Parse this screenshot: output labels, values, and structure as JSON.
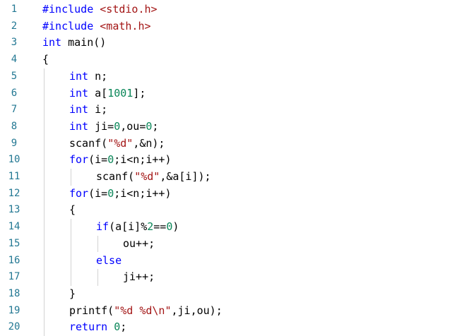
{
  "editor": {
    "colors": {
      "line_number": "#237893",
      "keyword": "#0000ff",
      "string": "#a31515",
      "number": "#098658",
      "text": "#000000",
      "indent_guide": "#d3d3d3"
    },
    "lines": [
      {
        "number": "1",
        "indent": 0,
        "tokens": [
          {
            "t": "#include",
            "k": "preproc"
          },
          {
            "t": " ",
            "k": "plain"
          },
          {
            "t": "<stdio.h>",
            "k": "include"
          }
        ]
      },
      {
        "number": "2",
        "indent": 0,
        "tokens": [
          {
            "t": "#include",
            "k": "preproc"
          },
          {
            "t": " ",
            "k": "plain"
          },
          {
            "t": "<math.h>",
            "k": "include"
          }
        ]
      },
      {
        "number": "3",
        "indent": 0,
        "tokens": [
          {
            "t": "int",
            "k": "keyword"
          },
          {
            "t": " main()",
            "k": "plain"
          }
        ]
      },
      {
        "number": "4",
        "indent": 0,
        "tokens": [
          {
            "t": "{",
            "k": "plain"
          }
        ]
      },
      {
        "number": "5",
        "indent": 1,
        "tokens": [
          {
            "t": "int",
            "k": "keyword"
          },
          {
            "t": " n;",
            "k": "plain"
          }
        ]
      },
      {
        "number": "6",
        "indent": 1,
        "tokens": [
          {
            "t": "int",
            "k": "keyword"
          },
          {
            "t": " a[",
            "k": "plain"
          },
          {
            "t": "1001",
            "k": "number"
          },
          {
            "t": "];",
            "k": "plain"
          }
        ]
      },
      {
        "number": "7",
        "indent": 1,
        "tokens": [
          {
            "t": "int",
            "k": "keyword"
          },
          {
            "t": " i;",
            "k": "plain"
          }
        ]
      },
      {
        "number": "8",
        "indent": 1,
        "tokens": [
          {
            "t": "int",
            "k": "keyword"
          },
          {
            "t": " ji=",
            "k": "plain"
          },
          {
            "t": "0",
            "k": "number"
          },
          {
            "t": ",ou=",
            "k": "plain"
          },
          {
            "t": "0",
            "k": "number"
          },
          {
            "t": ";",
            "k": "plain"
          }
        ]
      },
      {
        "number": "9",
        "indent": 1,
        "tokens": [
          {
            "t": "scanf(",
            "k": "plain"
          },
          {
            "t": "\"%d\"",
            "k": "string"
          },
          {
            "t": ",&n);",
            "k": "plain"
          }
        ]
      },
      {
        "number": "10",
        "indent": 1,
        "tokens": [
          {
            "t": "for",
            "k": "keyword"
          },
          {
            "t": "(i=",
            "k": "plain"
          },
          {
            "t": "0",
            "k": "number"
          },
          {
            "t": ";i<n;i++)",
            "k": "plain"
          }
        ]
      },
      {
        "number": "11",
        "indent": 2,
        "tokens": [
          {
            "t": "scanf(",
            "k": "plain"
          },
          {
            "t": "\"%d\"",
            "k": "string"
          },
          {
            "t": ",&a[i]);",
            "k": "plain"
          }
        ]
      },
      {
        "number": "12",
        "indent": 1,
        "tokens": [
          {
            "t": "for",
            "k": "keyword"
          },
          {
            "t": "(i=",
            "k": "plain"
          },
          {
            "t": "0",
            "k": "number"
          },
          {
            "t": ";i<n;i++)",
            "k": "plain"
          }
        ]
      },
      {
        "number": "13",
        "indent": 1,
        "tokens": [
          {
            "t": "{",
            "k": "plain"
          }
        ]
      },
      {
        "number": "14",
        "indent": 2,
        "tokens": [
          {
            "t": "if",
            "k": "keyword"
          },
          {
            "t": "(a[i]%",
            "k": "plain"
          },
          {
            "t": "2",
            "k": "number"
          },
          {
            "t": "==",
            "k": "plain"
          },
          {
            "t": "0",
            "k": "number"
          },
          {
            "t": ")",
            "k": "plain"
          }
        ]
      },
      {
        "number": "15",
        "indent": 3,
        "tokens": [
          {
            "t": "ou++;",
            "k": "plain"
          }
        ]
      },
      {
        "number": "16",
        "indent": 2,
        "tokens": [
          {
            "t": "else",
            "k": "keyword"
          }
        ]
      },
      {
        "number": "17",
        "indent": 3,
        "tokens": [
          {
            "t": "ji++;",
            "k": "plain"
          }
        ]
      },
      {
        "number": "18",
        "indent": 1,
        "tokens": [
          {
            "t": "}",
            "k": "plain"
          }
        ]
      },
      {
        "number": "19",
        "indent": 1,
        "tokens": [
          {
            "t": "printf(",
            "k": "plain"
          },
          {
            "t": "\"%d %d\\n\"",
            "k": "string"
          },
          {
            "t": ",ji,ou);",
            "k": "plain"
          }
        ]
      },
      {
        "number": "20",
        "indent": 1,
        "tokens": [
          {
            "t": "return",
            "k": "keyword"
          },
          {
            "t": " ",
            "k": "plain"
          },
          {
            "t": "0",
            "k": "number"
          },
          {
            "t": ";",
            "k": "plain"
          }
        ]
      }
    ]
  }
}
